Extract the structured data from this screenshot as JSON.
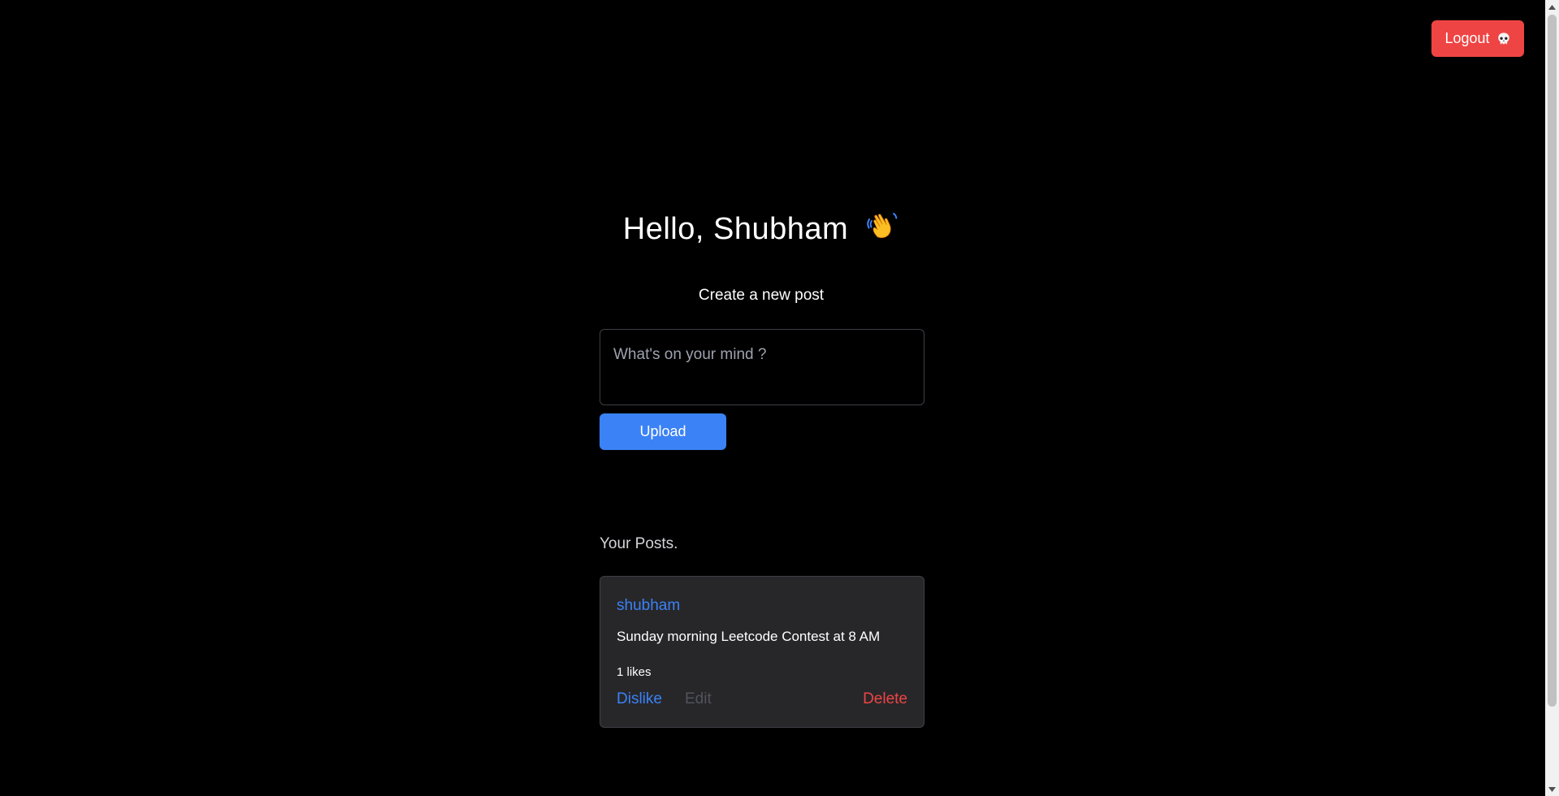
{
  "header": {
    "logout_label": "Logout",
    "logout_icon": "skull-icon"
  },
  "greeting": {
    "prefix": "Hello, ",
    "name": "Shubham",
    "icon": "waving-hand-icon"
  },
  "composer": {
    "title": "Create a new post",
    "placeholder": "What's on your mind ?",
    "value": "",
    "upload_label": "Upload"
  },
  "posts_section": {
    "heading": "Your Posts.",
    "posts": [
      {
        "author": "shubham",
        "content": "Sunday morning Leetcode Contest at 8 AM",
        "likes_text": "1 likes",
        "dislike_label": "Dislike",
        "edit_label": "Edit",
        "delete_label": "Delete"
      }
    ]
  },
  "colors": {
    "background": "#000000",
    "danger": "#ef4444",
    "primary": "#3b82f6",
    "card": "#27272a"
  }
}
